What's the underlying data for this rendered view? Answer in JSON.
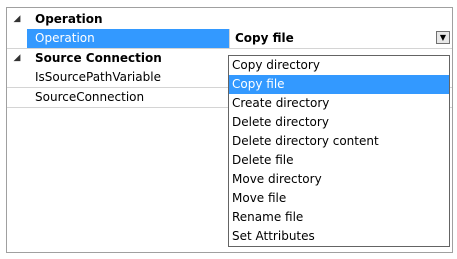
{
  "categories": [
    {
      "label": "Operation",
      "expander": "◢",
      "properties": [
        {
          "name": "Operation",
          "value": "Copy file",
          "selected": true
        }
      ]
    },
    {
      "label": "Source Connection",
      "expander": "◢",
      "properties": [
        {
          "name": "IsSourcePathVariable"
        },
        {
          "name": "SourceConnection"
        }
      ]
    }
  ],
  "dropdown": {
    "button_glyph": "▼",
    "selected_index": 1,
    "options": [
      "Copy directory",
      "Copy file",
      "Create directory",
      "Delete directory",
      "Delete directory content",
      "Delete file",
      "Move directory",
      "Move file",
      "Rename file",
      "Set Attributes"
    ]
  },
  "colors": {
    "selection": "#3399ff",
    "grid_line": "#d4d4d4",
    "border": "#a0a0a0"
  }
}
